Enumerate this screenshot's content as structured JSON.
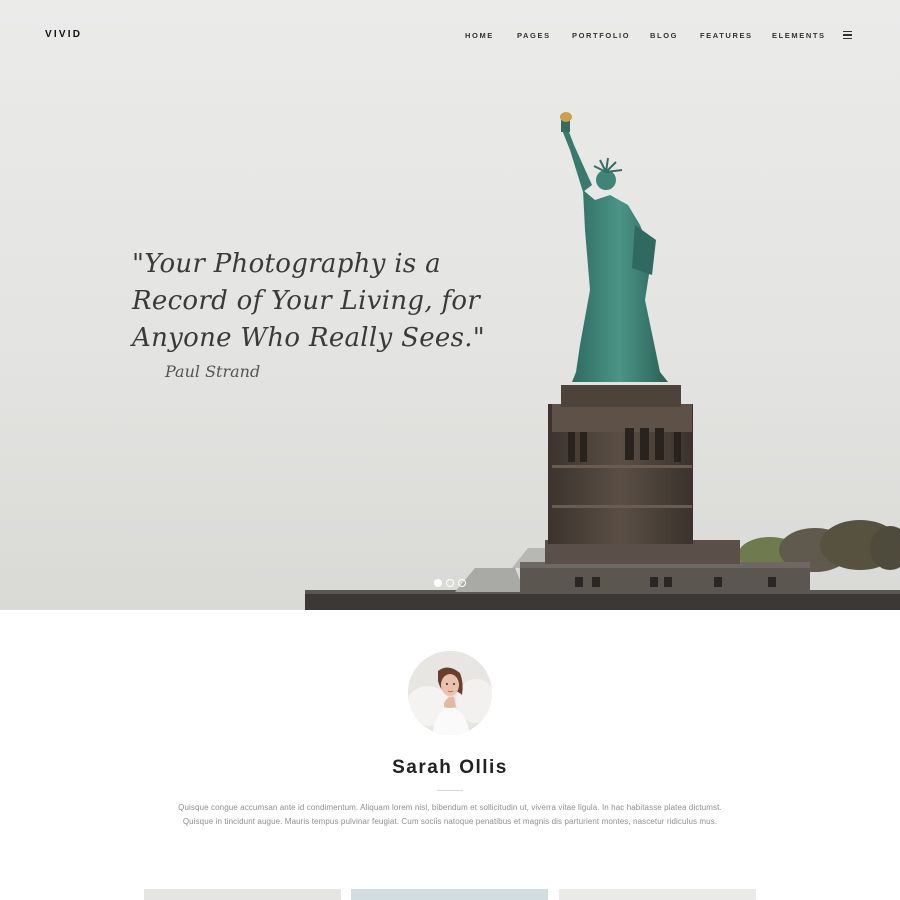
{
  "header": {
    "brand": "VIVID",
    "nav": [
      "HOME",
      "PAGES",
      "PORTFOLIO",
      "BLOG",
      "FEATURES",
      "ELEMENTS"
    ],
    "menu_icon": "hamburger-menu-icon"
  },
  "hero": {
    "quote": "\"Your Photography is a Record of Your Living, for Anyone Who Really Sees.\"",
    "author": "Paul Strand",
    "slider": {
      "count": 3,
      "active": 1
    }
  },
  "profile": {
    "name": "Sarah Ollis",
    "bio": "Quisque congue accumsan ante id condimentum. Aliquam lorem nisl, bibendum et sollicitudin ut, viverra vitae ligula. In hac habitasse platea dictumst. Quisque in tincidunt augue. Mauris tempus pulvinar feugiat. Cum sociis natoque penatibus et magnis dis parturient montes, nascetur ridiculus mus."
  },
  "colors": {
    "text_dark": "#222222",
    "text_muted": "#8f8f8f",
    "statue_green": "#3e7f73",
    "pedestal_brown": "#4a3f37"
  }
}
